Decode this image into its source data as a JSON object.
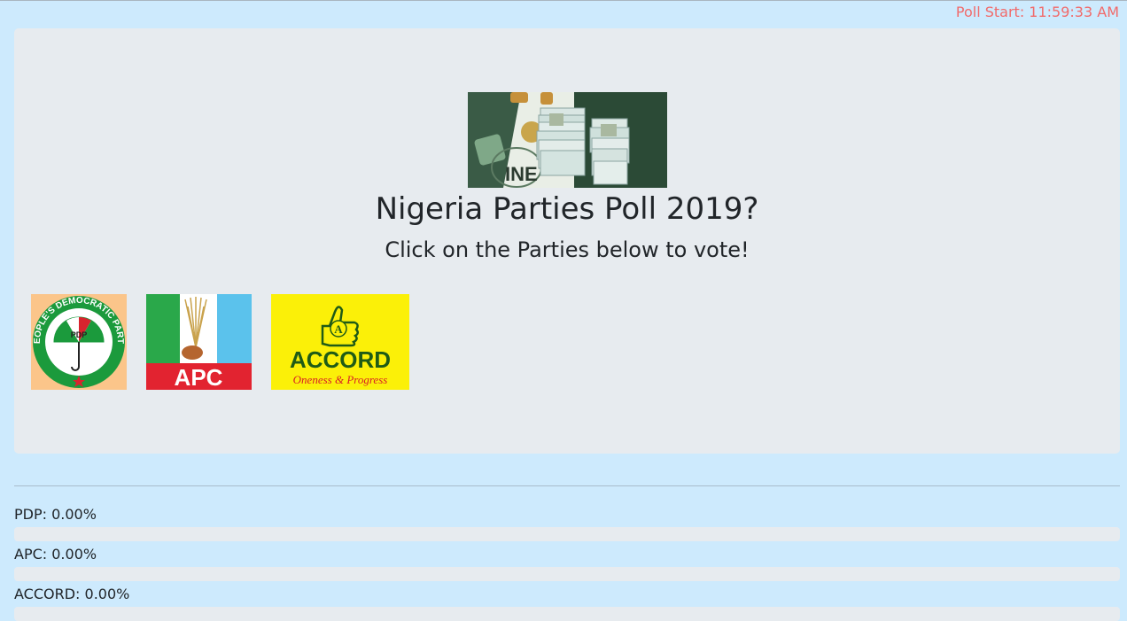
{
  "header": {
    "poll_start": "Poll Start: 11:59:33 AM"
  },
  "hero": {
    "image_icon": "voter-cards-image",
    "title": "Nigeria Parties Poll 2019?",
    "subtitle": "Click on the Parties below to vote!"
  },
  "parties": [
    {
      "name": "PDP",
      "logo_text": "PEOPLE'S DEMOCRATIC PARTY",
      "logo_initials": "PDP",
      "colors": {
        "background": "#fbc58a",
        "green": "#1b9a3c",
        "red": "#d9232e"
      }
    },
    {
      "name": "APC",
      "logo_text": "APC",
      "colors": {
        "green": "#2aa84a",
        "blue": "#5bc2ec",
        "red": "#e22330"
      }
    },
    {
      "name": "ACCORD",
      "logo_text": "ACCORD",
      "logo_initials": "A",
      "logo_tagline": "Oneness & Progress",
      "colors": {
        "background": "#fbf008",
        "green": "#1f5b16",
        "red": "#d81f26"
      }
    }
  ],
  "results": [
    {
      "label": "PDP: 0.00%",
      "percent": 0
    },
    {
      "label": "APC: 0.00%",
      "percent": 0
    },
    {
      "label": "ACCORD: 0.00%",
      "percent": 0
    }
  ],
  "colors": {
    "page_background": "#cdeafd",
    "panel_background": "#e7ebef",
    "poll_start_text": "#f16b6b"
  }
}
